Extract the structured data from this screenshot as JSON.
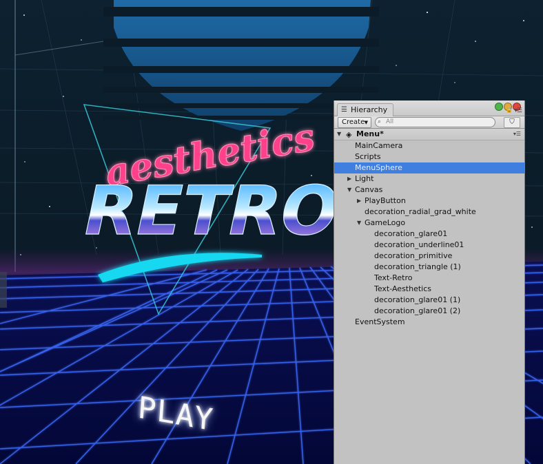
{
  "game_view": {
    "logo_script": "aesthetics",
    "logo_main": "RETRO",
    "play_label": "PLAY"
  },
  "hierarchy": {
    "tab_label": "Hierarchy",
    "tab_icon": "list-icon",
    "window_lights": [
      "#4fb54a",
      "#e3a93a",
      "#e0483f"
    ],
    "toolbar": {
      "create_label": "Create",
      "search_placeholder": "All"
    },
    "scene_name": "Menu*",
    "selection_color": "#3f7fe0",
    "items": [
      {
        "label": "MainCamera",
        "depth": 0,
        "arrow": "none",
        "selected": false
      },
      {
        "label": "Scripts",
        "depth": 0,
        "arrow": "none",
        "selected": false
      },
      {
        "label": "MenuSphere",
        "depth": 0,
        "arrow": "none",
        "selected": true
      },
      {
        "label": "Light",
        "depth": 0,
        "arrow": "collapsed",
        "selected": false
      },
      {
        "label": "Canvas",
        "depth": 0,
        "arrow": "expanded",
        "selected": false
      },
      {
        "label": "PlayButton",
        "depth": 1,
        "arrow": "collapsed",
        "selected": false
      },
      {
        "label": "decoration_radial_grad_white",
        "depth": 1,
        "arrow": "none",
        "selected": false
      },
      {
        "label": "GameLogo",
        "depth": 1,
        "arrow": "expanded",
        "selected": false
      },
      {
        "label": "decoration_glare01",
        "depth": 2,
        "arrow": "none",
        "selected": false
      },
      {
        "label": "decoration_underline01",
        "depth": 2,
        "arrow": "none",
        "selected": false
      },
      {
        "label": "decoration_primitive",
        "depth": 2,
        "arrow": "none",
        "selected": false
      },
      {
        "label": "decoration_triangle (1)",
        "depth": 2,
        "arrow": "none",
        "selected": false
      },
      {
        "label": "Text-Retro",
        "depth": 2,
        "arrow": "none",
        "selected": false
      },
      {
        "label": "Text-Aesthetics",
        "depth": 2,
        "arrow": "none",
        "selected": false
      },
      {
        "label": "decoration_glare01 (1)",
        "depth": 2,
        "arrow": "none",
        "selected": false
      },
      {
        "label": "decoration_glare01 (2)",
        "depth": 2,
        "arrow": "none",
        "selected": false
      },
      {
        "label": "EventSystem",
        "depth": 0,
        "arrow": "none",
        "selected": false
      }
    ]
  }
}
